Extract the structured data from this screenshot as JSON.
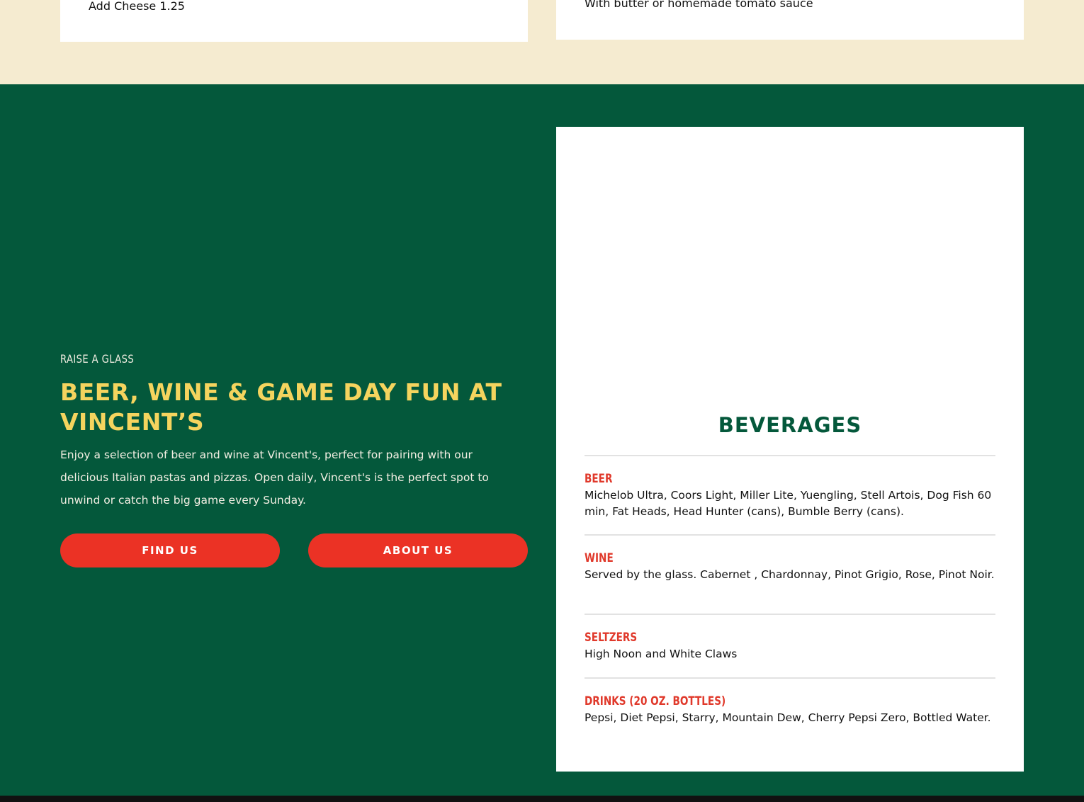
{
  "top_cards": {
    "left_text": "Add Cheese 1.25",
    "right_text": "With butter or homemade tomato sauce"
  },
  "promo": {
    "eyebrow": "RAISE A GLASS",
    "headline": "BEER, WINE & GAME DAY FUN AT VINCENT’S",
    "body": "Enjoy a selection of beer and wine at Vincent's, perfect for pairing with our delicious Italian pastas and pizzas. Open daily, Vincent's is the perfect spot to unwind or catch the big game every Sunday.",
    "buttons": {
      "find_us": "FIND US",
      "about_us": "ABOUT US"
    }
  },
  "beverages": {
    "title": "BEVERAGES",
    "items": [
      {
        "name": "BEER",
        "description": "Michelob Ultra, Coors Light, Miller Lite, Yuengling, Stell Artois, Dog Fish 60 min, Fat Heads, Head Hunter (cans), Bumble Berry (cans)."
      },
      {
        "name": "WINE",
        "description": "Served by the glass. Cabernet , Chardonnay, Pinot Grigio, Rose, Pinot Noir."
      },
      {
        "name": "SELTZERS",
        "description": "High Noon and White Claws"
      },
      {
        "name": "DRINKS (20 OZ. BOTTLES)",
        "description": "Pepsi, Diet Pepsi, Starry, Mountain Dew, Cherry Pepsi Zero, Bottled Water."
      }
    ]
  },
  "colors": {
    "cream": "#F5EBD0",
    "green": "#04583B",
    "yellow": "#F5D45E",
    "red": "#EB3225"
  }
}
